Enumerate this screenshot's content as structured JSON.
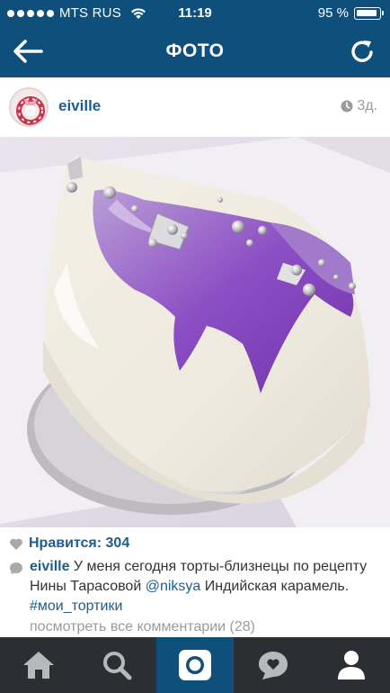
{
  "status_bar": {
    "carrier": "MTS RUS",
    "time": "11:19",
    "battery": "95 %"
  },
  "nav": {
    "title": "ФОТО",
    "back_icon": "arrow-left-icon",
    "refresh_icon": "refresh-icon"
  },
  "post": {
    "username": "eiville",
    "time": "3д.",
    "likes_label": "Нравится: 304",
    "caption": {
      "user": "eiville",
      "text_1": " У меня сегодня торты-близнецы по рецепту Нины Тарасовой ",
      "mention": "@niksya",
      "text_2": " Индийская карамель. ",
      "hashtag": "#мои_тортики"
    },
    "view_all_comments": "посмотреть все комментарии (28)"
  },
  "tabbar": {
    "items": [
      {
        "icon": "home-icon",
        "active": false
      },
      {
        "icon": "search-icon",
        "active": false
      },
      {
        "icon": "camera-icon",
        "active": true
      },
      {
        "icon": "activity-icon",
        "active": false
      },
      {
        "icon": "profile-icon",
        "active": false
      }
    ]
  },
  "colors": {
    "header_blue": "#0e4f7c",
    "link_blue": "#1f5d8c",
    "tabbar_dark": "#2b2f33",
    "muted_gray": "#9b9b9b"
  }
}
